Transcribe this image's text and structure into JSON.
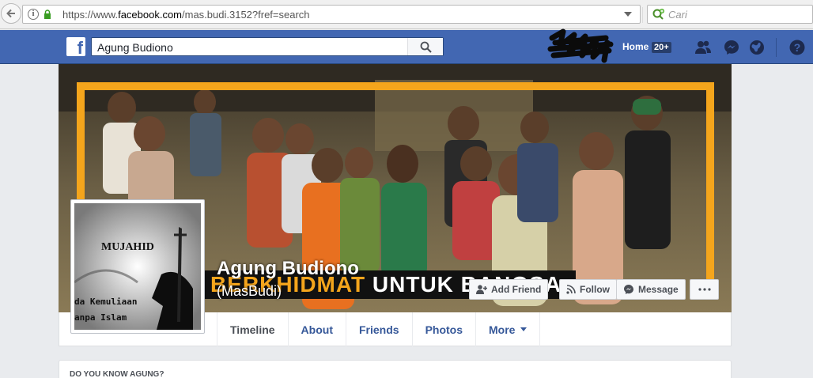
{
  "browser": {
    "url_prefix": "https://www.",
    "url_domain": "facebook.com",
    "url_path": "/mas.budi.3152?fref=search",
    "search_placeholder": "Cari"
  },
  "topbar": {
    "search_value": "Agung Budiono",
    "home_label": "Home",
    "home_badge": "20+",
    "logo_letter": "f"
  },
  "cover": {
    "banner_text_highlight": "BERKHIDMAT",
    "banner_text_rest": " UNTUK BANGSA"
  },
  "profile": {
    "name": "Agung Budiono",
    "alternate_name": "(MasBudi)",
    "picture_title": "MUJAHID",
    "picture_line1": "da Kemuliaan",
    "picture_line2": "anpa Islam"
  },
  "actions": {
    "add_friend": "Add Friend",
    "follow": "Follow",
    "message": "Message"
  },
  "tabs": [
    {
      "label": "Timeline"
    },
    {
      "label": "About"
    },
    {
      "label": "Friends"
    },
    {
      "label": "Photos"
    },
    {
      "label": "More"
    }
  ],
  "sections": {
    "know_title": "DO YOU KNOW AGUNG?"
  },
  "colors": {
    "fb_blue": "#4267b2",
    "cover_accent": "#f4a51c",
    "link": "#365899"
  }
}
